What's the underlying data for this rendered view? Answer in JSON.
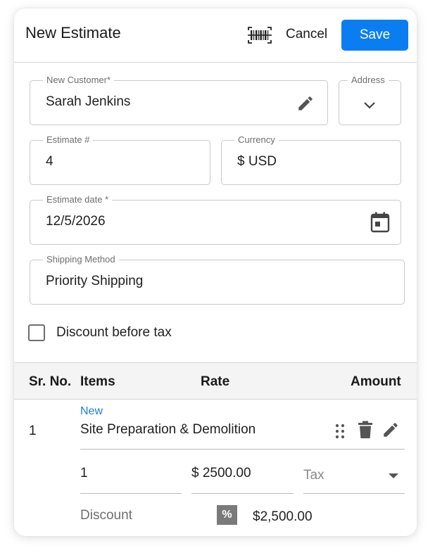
{
  "header": {
    "title": "New Estimate",
    "cancel_label": "Cancel",
    "save_label": "Save",
    "scan_icon": "barcode-scan-icon"
  },
  "form": {
    "customer": {
      "label": "New Customer*",
      "value": "Sarah Jenkins",
      "icon": "pencil-icon"
    },
    "address": {
      "label": "Address",
      "icon": "chevron-down-icon"
    },
    "estimate_no": {
      "label": "Estimate #",
      "value": "4"
    },
    "currency": {
      "label": "Currency",
      "value": "$ USD"
    },
    "estimate_date": {
      "label": "Estimate date *",
      "value": "12/5/2026",
      "icon": "calendar-icon"
    },
    "shipping_method": {
      "label": "Shipping Method",
      "value": "Priority Shipping"
    },
    "discount_before_tax": {
      "label": "Discount before tax",
      "checked": false
    }
  },
  "table": {
    "headers": {
      "sr_no": "Sr. No.",
      "items": "Items",
      "rate": "Rate",
      "amount": "Amount"
    },
    "rows": [
      {
        "sr_no": "1",
        "badge": "New",
        "item": "Site Preparation & Demolition",
        "quantity": "1",
        "rate": "$ 2500.00",
        "tax_placeholder": "Tax",
        "discount_label": "Discount",
        "discount_type": "%",
        "amount": "$2,500.00"
      }
    ]
  },
  "colors": {
    "accent": "#0a7ef0",
    "badge": "#1a7fd8",
    "border": "#c9c9c9"
  }
}
